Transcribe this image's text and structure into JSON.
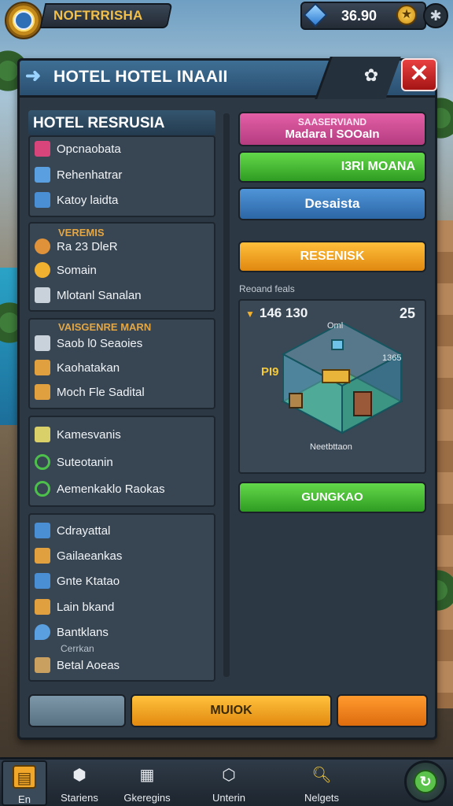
{
  "topbar": {
    "player_name": "NOFTRRISHA",
    "gems": "36.90"
  },
  "header": {
    "title": "HOTEL HOTEL INAAII"
  },
  "left": {
    "title": "HOTEL RESRUSIA",
    "groups": [
      {
        "items": [
          {
            "label": "Opcnaobata",
            "icon": "gift-icon",
            "color": "#d8457a"
          },
          {
            "label": "Rehenhatrar",
            "icon": "pencil-icon",
            "color": "#5aa0e0"
          },
          {
            "label": "Katoy laidta",
            "icon": "checkbox-icon",
            "color": "#4a8fd4"
          }
        ]
      },
      {
        "title": "VEREMIS",
        "items": [
          {
            "label": "Ra 23 DleR",
            "icon": "clock-icon",
            "color": "#e0923a"
          },
          {
            "label": "Somain",
            "icon": "coin-icon",
            "color": "#f0b030"
          },
          {
            "label": "Mlotanl Sanalan",
            "icon": "building-icon",
            "color": "#c9d2da"
          }
        ]
      },
      {
        "title": "VAISGENRE MARN",
        "items": [
          {
            "label": "Saob l0 Seaoies",
            "icon": "calendar-icon",
            "color": "#c9d2da"
          },
          {
            "label": "Kaohatakan",
            "icon": "map-icon",
            "color": "#e0a040"
          },
          {
            "label": "Moch Fle Sadital",
            "icon": "tools-icon",
            "color": "#e0a040"
          }
        ]
      },
      {
        "items": [
          {
            "label": "Kamesvanis",
            "icon": "note-icon",
            "color": "#d9d06a"
          },
          {
            "label": "Suteotanin",
            "icon": "refresh-icon",
            "color": "#4cc04a"
          },
          {
            "label": "Aemenkaklo Raokas",
            "icon": "circle-icon",
            "color": "#4cc04a"
          }
        ]
      },
      {
        "items": [
          {
            "label": "Cdrayattal",
            "icon": "grid-icon",
            "color": "#4a8fd4"
          },
          {
            "label": "Gailaeankas",
            "icon": "list-icon",
            "color": "#e0a040"
          },
          {
            "label": "Gnte Ktatao",
            "icon": "monitor-icon",
            "color": "#4a8fd4"
          },
          {
            "label": "Lain bkand",
            "icon": "wrench-icon",
            "color": "#e0a040"
          },
          {
            "label": "Bantklans",
            "icon": "drop-icon",
            "color": "#5aa0e0"
          },
          {
            "label": "Betal Aoeas",
            "icon": "barrel-icon",
            "color": "#c9a060"
          }
        ],
        "note": "Cerrkan"
      }
    ]
  },
  "right": {
    "pink_line1": "SAASERVIAND",
    "pink_line2": "Madara l SOOaIn",
    "green_label": "I3RI MOANA",
    "blue_label": "Desaista",
    "orange_label": "RESENISK",
    "section_label": "Reoand feals",
    "room": {
      "count": "146 130",
      "number": "25",
      "tag_top": "Oml",
      "tag_right": "1365",
      "tag_left": "PI9",
      "tag_bottom": "Neetbttaon"
    },
    "green2_label": "GUNGKAO"
  },
  "bottom": {
    "main_label": "MUIOK"
  },
  "nav": [
    {
      "label": "En",
      "icon": "home-icon"
    },
    {
      "label": "Stariens",
      "icon": "shield-icon"
    },
    {
      "label": "Gkeregins",
      "icon": "crate-icon"
    },
    {
      "label": "Unterin",
      "icon": "badge-icon"
    },
    {
      "label": "Nelgets",
      "icon": "magnifier-icon"
    }
  ]
}
